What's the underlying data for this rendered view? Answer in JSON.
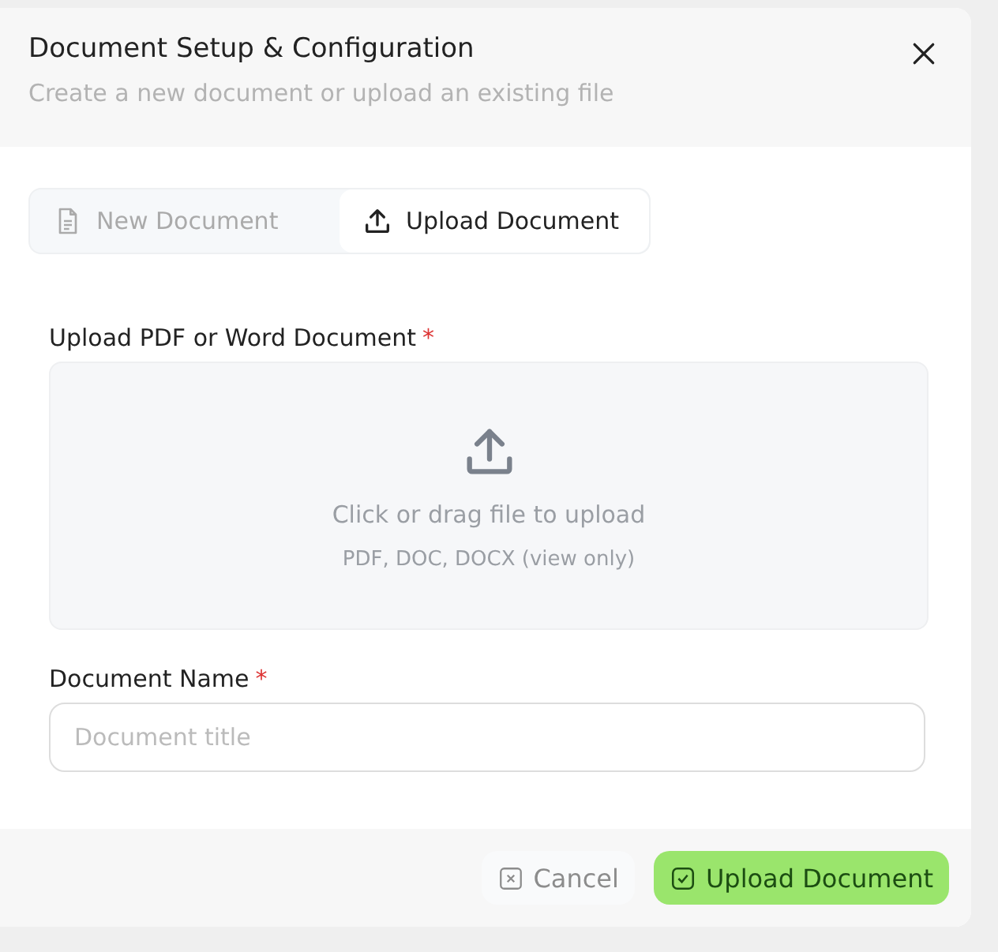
{
  "dialog": {
    "title": "Document Setup & Configuration",
    "subtitle": "Create a new document or upload an existing file"
  },
  "tabs": [
    {
      "label": "New Document",
      "selected": false
    },
    {
      "label": "Upload Document",
      "selected": true
    }
  ],
  "upload": {
    "label": "Upload PDF or Word Document",
    "required_mark": "*",
    "prompt": "Click or drag file to upload",
    "hint": "PDF, DOC, DOCX (view only)"
  },
  "name_field": {
    "label": "Document Name",
    "required_mark": "*",
    "placeholder": "Document title"
  },
  "buttons": [
    {
      "label": "Cancel",
      "kind": "secondary"
    },
    {
      "label": "Upload Document",
      "kind": "primary"
    }
  ]
}
